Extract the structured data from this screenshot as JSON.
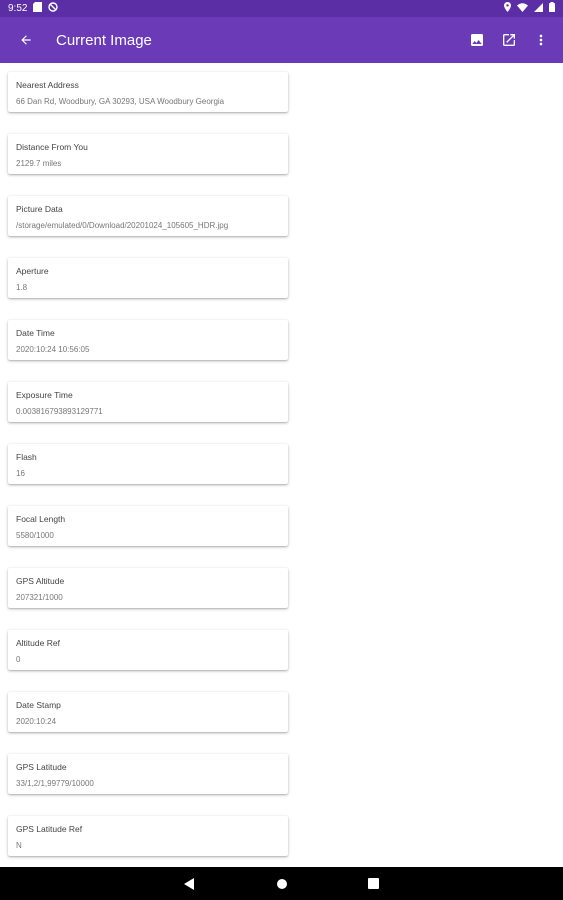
{
  "status_bar": {
    "time": "9:52"
  },
  "app_bar": {
    "title": "Current Image"
  },
  "cards": [
    {
      "label": "Nearest Address",
      "value": "66 Dan Rd, Woodbury, GA 30293, USA Woodbury Georgia"
    },
    {
      "label": "Distance From You",
      "value": "2129.7 miles"
    },
    {
      "label": "Picture Data",
      "value": "/storage/emulated/0/Download/20201024_105605_HDR.jpg"
    },
    {
      "label": "Aperture",
      "value": "1.8"
    },
    {
      "label": "Date Time",
      "value": "2020:10:24 10:56:05"
    },
    {
      "label": "Exposure Time",
      "value": "0.003816793893129771"
    },
    {
      "label": "Flash",
      "value": "16"
    },
    {
      "label": "Focal Length",
      "value": "5580/1000"
    },
    {
      "label": "GPS Altitude",
      "value": "207321/1000"
    },
    {
      "label": "Altitude Ref",
      "value": "0"
    },
    {
      "label": "Date Stamp",
      "value": "2020:10:24"
    },
    {
      "label": "GPS Latitude",
      "value": "33/1,2/1,99779/10000"
    },
    {
      "label": "GPS Latitude Ref",
      "value": "N"
    }
  ]
}
